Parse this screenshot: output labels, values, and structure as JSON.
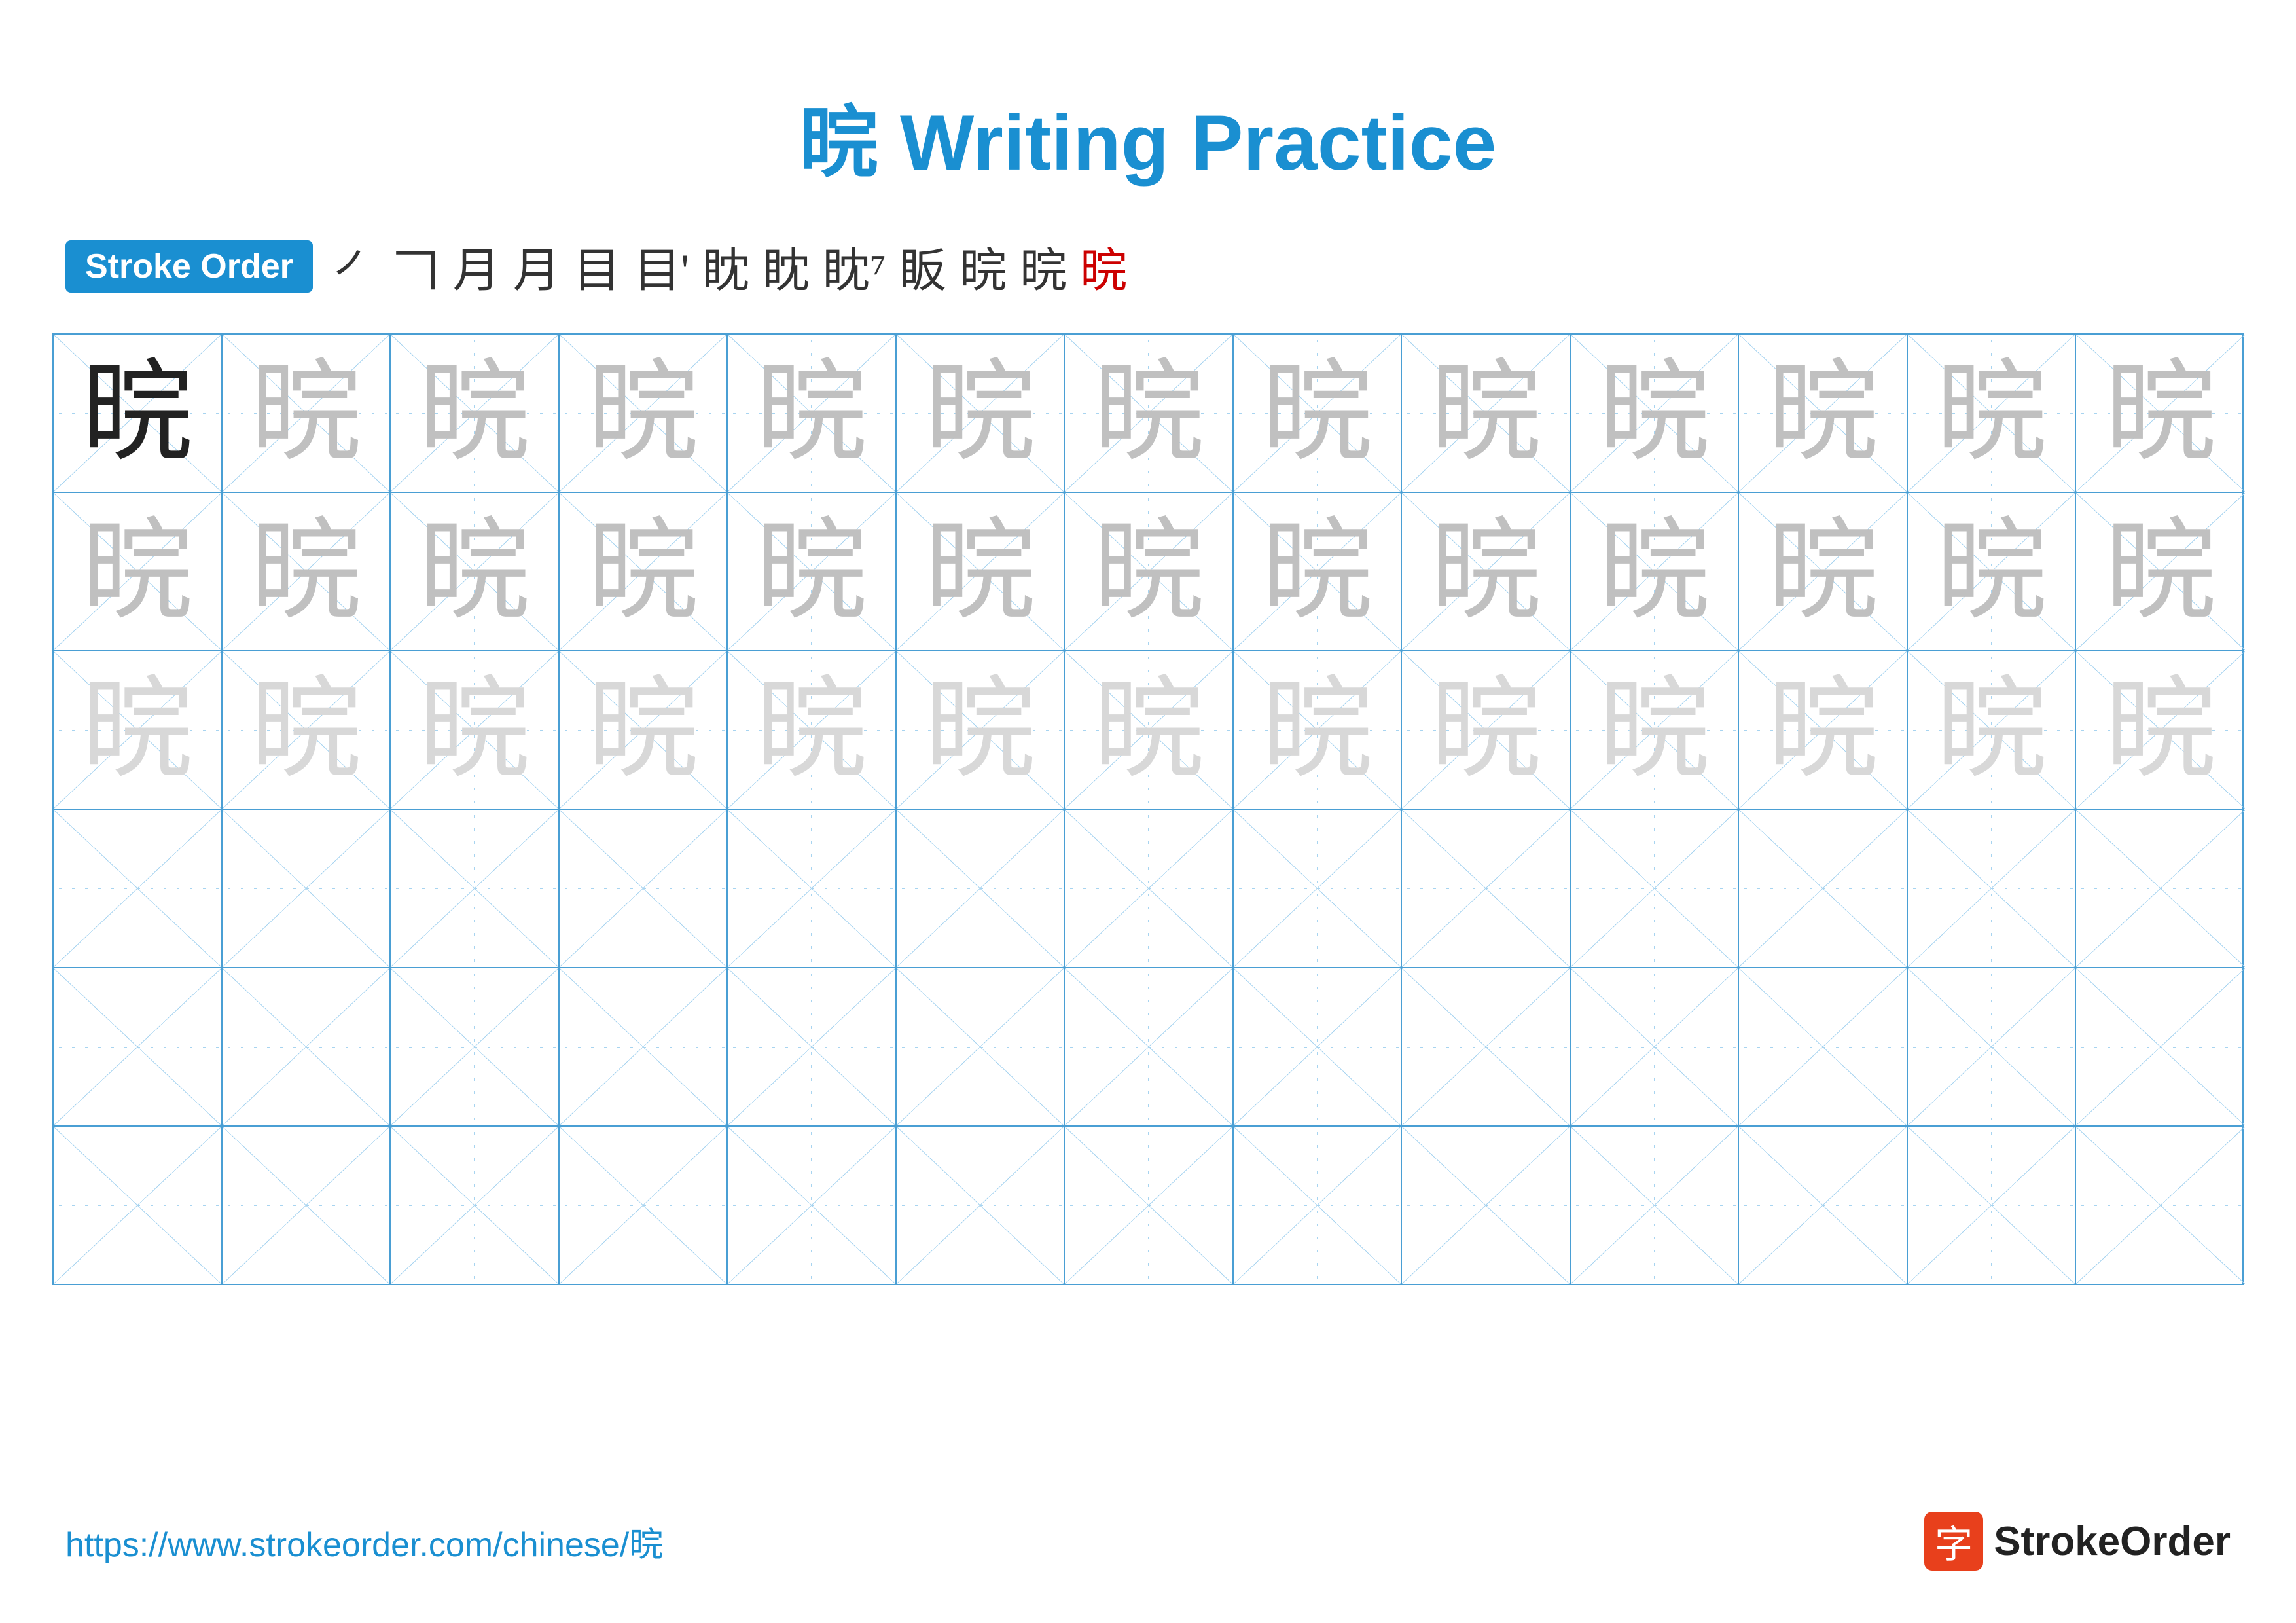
{
  "title": {
    "prefix_char": "晥",
    "main": "Writing Practice",
    "full": "晥 Writing Practice"
  },
  "stroke_order": {
    "badge_label": "Stroke Order",
    "strokes": [
      "㇒",
      "𠃍",
      "月",
      "月",
      "目",
      "目'",
      "眈",
      "眈",
      "眈⁷",
      "眅",
      "晥",
      "晥",
      "晥"
    ],
    "last_red": true
  },
  "character": "晥",
  "grid": {
    "cols": 13,
    "rows": 6,
    "practice_rows": [
      {
        "type": "dark_then_light1",
        "char": "晥"
      },
      {
        "type": "light1",
        "char": "晥"
      },
      {
        "type": "light2",
        "char": "晥"
      },
      {
        "type": "empty"
      },
      {
        "type": "empty"
      },
      {
        "type": "empty"
      }
    ]
  },
  "footer": {
    "url": "https://www.strokeorder.com/chinese/晥",
    "logo_char": "字",
    "logo_text": "StrokeOrder"
  }
}
